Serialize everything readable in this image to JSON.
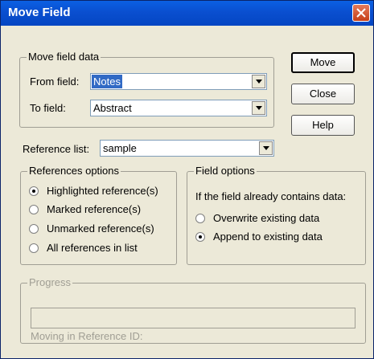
{
  "window": {
    "title": "Move Field",
    "close_label": "close"
  },
  "move_field_data": {
    "legend": "Move field data",
    "from_label": "From field:",
    "from_value": "Notes",
    "to_label": "To field:",
    "to_value": "Abstract"
  },
  "buttons": {
    "move": "Move",
    "close": "Close",
    "help": "Help"
  },
  "reference_list": {
    "label": "Reference list:",
    "value": "sample"
  },
  "references_options": {
    "legend": "References options",
    "options": [
      {
        "label": "Highlighted reference(s)",
        "selected": true
      },
      {
        "label": "Marked reference(s)",
        "selected": false
      },
      {
        "label": "Unmarked reference(s)",
        "selected": false
      },
      {
        "label": "All references in list",
        "selected": false
      }
    ]
  },
  "field_options": {
    "legend": "Field options",
    "prompt": "If the field already contains data:",
    "options": [
      {
        "label": "Overwrite existing data",
        "selected": false
      },
      {
        "label": "Append to existing data",
        "selected": true
      }
    ]
  },
  "progress": {
    "legend": "Progress",
    "status": "Moving in Reference ID:"
  },
  "colors": {
    "titlebar": "#0a4fd0",
    "dialog_bg": "#ece9d8",
    "selection": "#316ac5",
    "close_button": "#d6512c"
  }
}
